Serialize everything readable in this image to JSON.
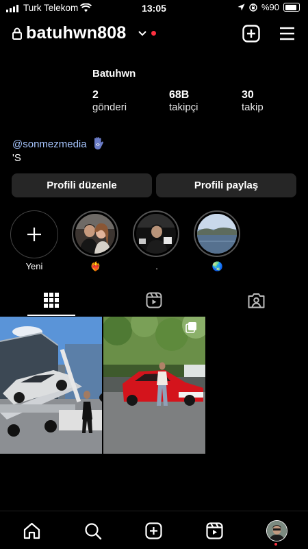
{
  "status_bar": {
    "carrier": "Turk Telekom",
    "time": "13:05",
    "battery": "%90"
  },
  "profile": {
    "username": "batuhwn808",
    "display_name": "Batuhwn",
    "stats": [
      {
        "value": "2",
        "label": "gönderi"
      },
      {
        "value": "68B",
        "label": "takipçi"
      },
      {
        "value": "30",
        "label": "takip"
      }
    ],
    "bio_link": "@sonmezmedia",
    "bio_line": "'S"
  },
  "buttons": {
    "edit": "Profili düzenle",
    "share": "Profili paylaş"
  },
  "highlights": [
    {
      "label": "Yeni",
      "icon": "plus-icon"
    },
    {
      "label": "❤️‍🔥",
      "icon": "couple-photo"
    },
    {
      "label": ".",
      "icon": "car-interior-photo"
    },
    {
      "label": "🌏",
      "icon": "lake-photo"
    }
  ],
  "tabs": [
    "grid-icon",
    "reels-icon",
    "tagged-icon"
  ],
  "posts": [
    "tow-truck-photo",
    "red-bmw-photo"
  ],
  "bottom_nav": [
    "home-icon",
    "search-icon",
    "create-icon",
    "reels-icon",
    "profile-avatar"
  ],
  "colors": {
    "background": "#000000",
    "button": "#262626",
    "link": "#a7c6ff",
    "notification": "#ff3040"
  }
}
